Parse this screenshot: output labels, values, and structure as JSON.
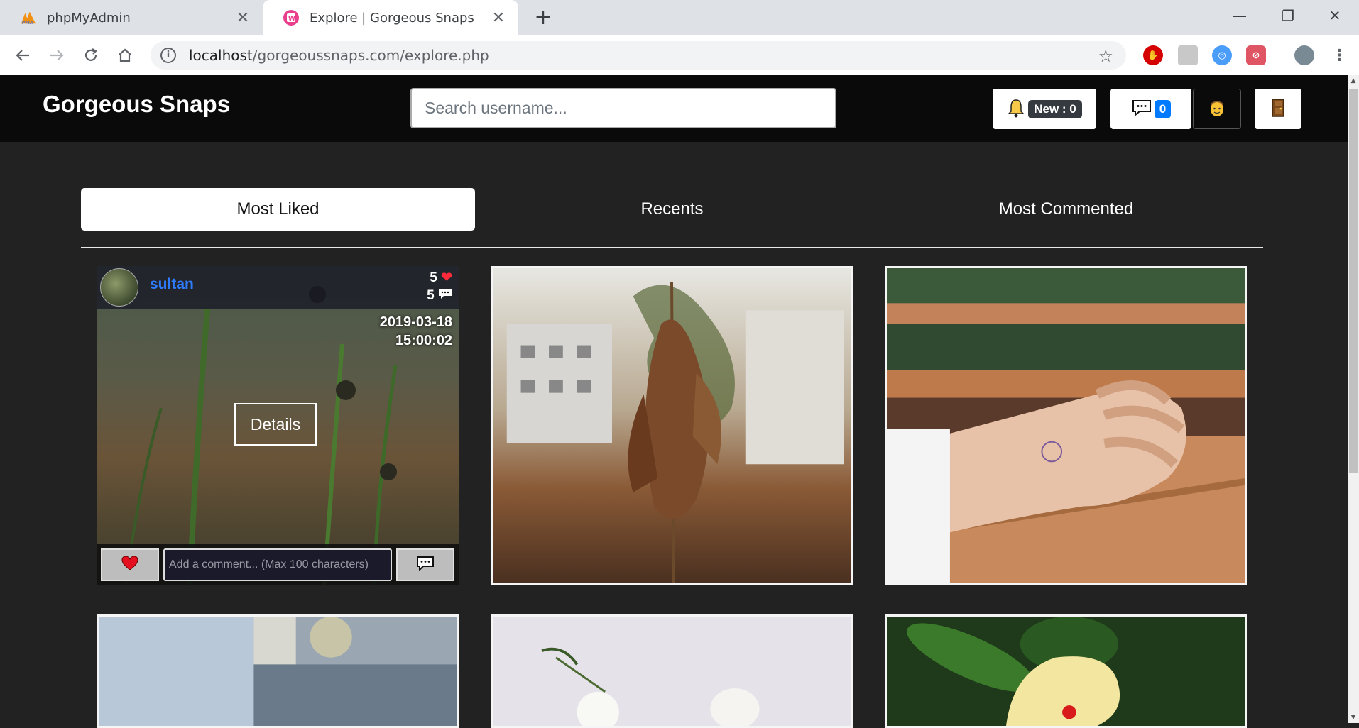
{
  "browser": {
    "tabs": [
      {
        "title": "phpMyAdmin",
        "active": false
      },
      {
        "title": "Explore | Gorgeous Snaps",
        "active": true
      }
    ],
    "url_host": "localhost",
    "url_path": "/gorgeoussnaps.com/explore.php"
  },
  "header": {
    "brand": "Gorgeous Snaps",
    "search_placeholder": "Search username...",
    "notifications_label": "New : 0",
    "messages_count": "0"
  },
  "filter_tabs": [
    {
      "label": "Most Liked",
      "active": true
    },
    {
      "label": "Recents",
      "active": false
    },
    {
      "label": "Most Commented",
      "active": false
    }
  ],
  "posts": [
    {
      "username": "sultan",
      "likes": "5",
      "comments": "5",
      "date": "2019-03-18",
      "time": "15:00:02",
      "details_label": "Details",
      "comment_placeholder": "Add a comment... (Max 100 characters)"
    }
  ]
}
